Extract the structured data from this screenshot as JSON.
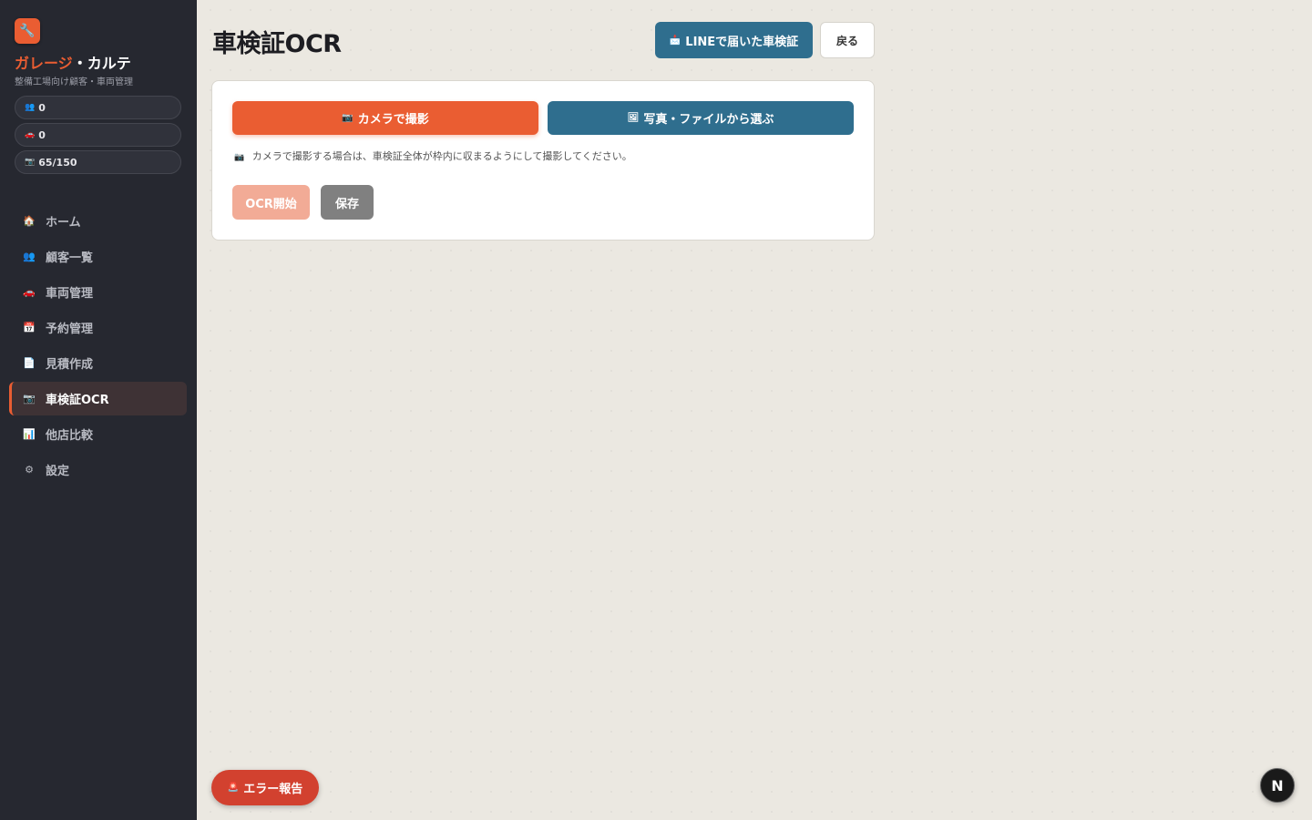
{
  "sidebar": {
    "logo_icon": "🔧",
    "brand_part1": "ガレージ",
    "brand_part2": "・カルテ",
    "subtitle": "整備工場向け顧客・車両管理",
    "stats": [
      {
        "icon": "👥",
        "value": "0"
      },
      {
        "icon": "🚗",
        "value": "0"
      },
      {
        "icon": "📷",
        "value": "65/150"
      }
    ],
    "nav": [
      {
        "icon": "🏠",
        "label": "ホーム"
      },
      {
        "icon": "👥",
        "label": "顧客一覧"
      },
      {
        "icon": "🚗",
        "label": "車両管理"
      },
      {
        "icon": "📅",
        "label": "予約管理"
      },
      {
        "icon": "📄",
        "label": "見積作成"
      },
      {
        "icon": "📷",
        "label": "車検証OCR"
      },
      {
        "icon": "📊",
        "label": "他店比較"
      },
      {
        "icon": "⚙",
        "label": "設定"
      }
    ],
    "active_index": 5
  },
  "header": {
    "title": "車検証OCR",
    "line_button_icon": "📩",
    "line_button_label": "LINEで届いた車検証",
    "back_button_label": "戻る"
  },
  "card": {
    "camera_icon": "📷",
    "camera_label": "カメラで撮影",
    "file_icon": "🖼",
    "file_label": "写真・ファイルから選ぶ",
    "hint_icon": "📷",
    "hint": "カメラで撮影する場合は、車検証全体が枠内に収まるようにして撮影してください。",
    "ocr_label": "OCR開始",
    "save_label": "保存"
  },
  "footer": {
    "error_icon": "🚨",
    "error_label": "エラー報告",
    "badge_label": "N"
  },
  "colors": {
    "accent": "#ea5d32",
    "secondary": "#2f6e8e",
    "sidebar_bg": "#262830",
    "page_bg": "#ebe8e1",
    "error": "#d2412f"
  }
}
